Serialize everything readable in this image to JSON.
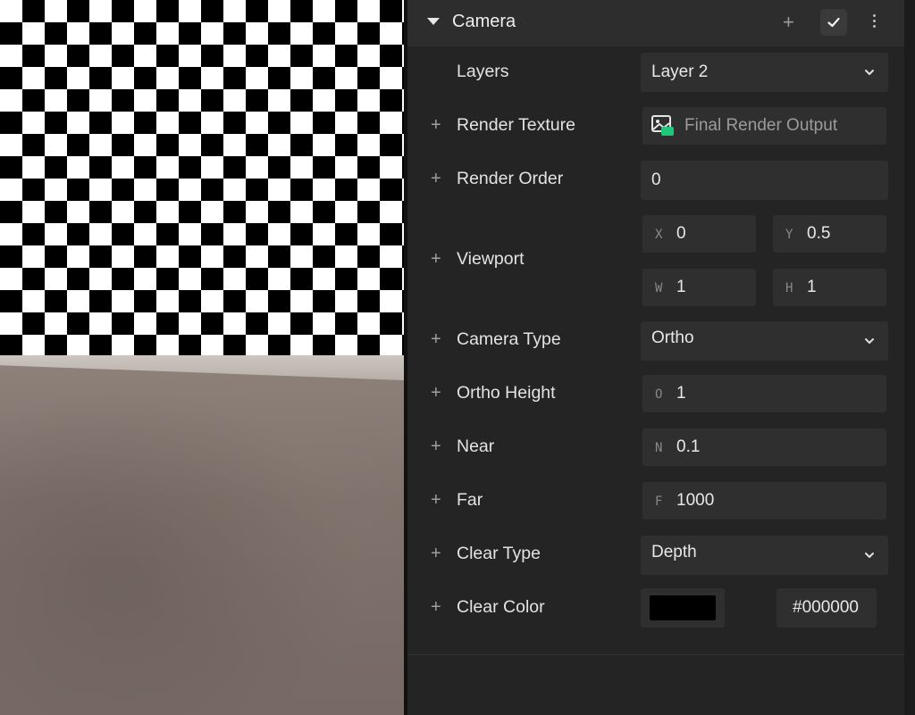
{
  "panel": {
    "title": "Camera",
    "rows": {
      "layers": {
        "label": "Layers",
        "value": "Layer 2"
      },
      "render_texture": {
        "label": "Render Texture",
        "value": "Final Render Output"
      },
      "render_order": {
        "label": "Render Order",
        "value": "0"
      },
      "viewport": {
        "label": "Viewport",
        "x": {
          "prefix": "X",
          "value": "0"
        },
        "y": {
          "prefix": "Y",
          "value": "0.5"
        },
        "w": {
          "prefix": "W",
          "value": "1"
        },
        "h": {
          "prefix": "H",
          "value": "1"
        }
      },
      "camera_type": {
        "label": "Camera Type",
        "value": "Ortho"
      },
      "ortho_height": {
        "label": "Ortho Height",
        "prefix": "O",
        "value": "1"
      },
      "near": {
        "label": "Near",
        "prefix": "N",
        "value": "0.1"
      },
      "far": {
        "label": "Far",
        "prefix": "F",
        "value": "1000"
      },
      "clear_type": {
        "label": "Clear Type",
        "value": "Depth"
      },
      "clear_color": {
        "label": "Clear Color",
        "hex": "#000000",
        "swatch_color": "#000000"
      }
    }
  },
  "icons": {
    "collapse": "caret-down-icon",
    "add": "plus-icon",
    "enabled": "checkmark-icon",
    "more": "kebab-menu-icon",
    "dropdown": "chevron-down-icon",
    "asset": "render-texture-asset-icon"
  },
  "colors": {
    "panel_bg": "#242424",
    "header_bg": "#2d2d2d",
    "field_bg": "#2f2f2f",
    "asset_accent": "#20c77a"
  }
}
